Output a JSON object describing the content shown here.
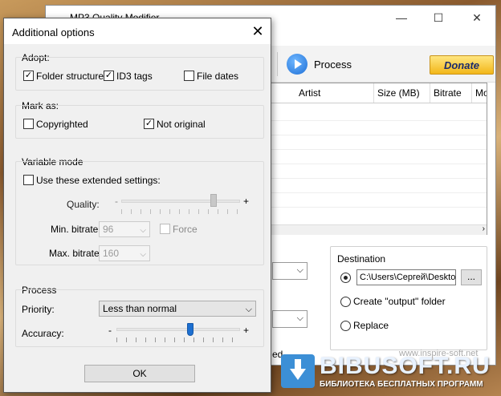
{
  "main_window": {
    "title": "MP3 Quality Modifier",
    "controls": {
      "minimize": "—",
      "maximize": "☐",
      "close": "✕"
    },
    "toolbar": {
      "process_label": "Process",
      "donate_label": "Donate"
    },
    "columns": [
      "Artist",
      "Size  (MB)",
      "Bitrate",
      "Mo"
    ],
    "destination": {
      "label": "Destination",
      "path_value": "C:\\Users\\Сергей\\Desktop",
      "browse_label": "...",
      "create_output_label": "Create \"output\" folder",
      "replace_label": "Replace",
      "selected": "path"
    },
    "status_fragment": "ed",
    "website": "www.inspire-soft.net"
  },
  "dialog": {
    "title": "Additional options",
    "adopt": {
      "label": "Adopt:",
      "folder_structure": {
        "label": "Folder structure",
        "checked": true
      },
      "id3_tags": {
        "label": "ID3 tags",
        "checked": true
      },
      "file_dates": {
        "label": "File dates",
        "checked": false
      }
    },
    "mark_as": {
      "label": "Mark as:",
      "copyrighted": {
        "label": "Copyrighted",
        "checked": false
      },
      "not_original": {
        "label": "Not original",
        "checked": true
      }
    },
    "variable_mode": {
      "label": "Variable mode",
      "use_extended": {
        "label": "Use these extended settings:",
        "checked": false
      },
      "quality_label": "Quality:",
      "quality_minus": "-",
      "quality_plus": "+",
      "quality_level": 0.78,
      "min_bitrate_label": "Min. bitrate:",
      "min_bitrate_value": "96",
      "force_label": "Force",
      "max_bitrate_label": "Max. bitrate:",
      "max_bitrate_value": "160"
    },
    "process": {
      "label": "Process",
      "priority_label": "Priority:",
      "priority_value": "Less than normal",
      "accuracy_label": "Accuracy:",
      "accuracy_minus": "-",
      "accuracy_plus": "+",
      "accuracy_level": 0.6
    },
    "ok_label": "OK"
  },
  "watermark": {
    "brand": "BIBUSOFT.RU",
    "tagline": "БИБЛИОТЕКА БЕСПЛАТНЫХ ПРОГРАММ"
  }
}
